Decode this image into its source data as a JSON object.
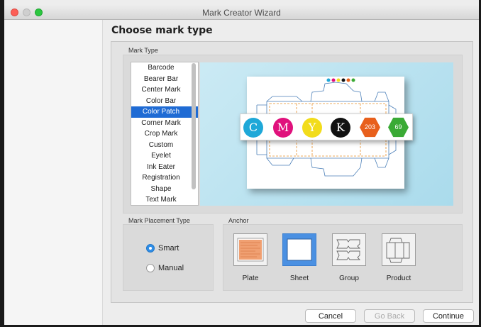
{
  "window": {
    "title": "Mark Creator Wizard"
  },
  "heading": "Choose mark type",
  "mark_type": {
    "label": "Mark Type",
    "items": [
      "Barcode",
      "Bearer Bar",
      "Center Mark",
      "Color Bar",
      "Color Patch",
      "Corner Mark",
      "Crop Mark",
      "Custom",
      "Eyelet",
      "Ink Eater",
      "Registration",
      "Shape",
      "Text Mark"
    ],
    "selected": "Color Patch"
  },
  "preview": {
    "patches": [
      {
        "label": "C",
        "color": "#1fa8d8"
      },
      {
        "label": "M",
        "color": "#e0117c"
      },
      {
        "label": "Y",
        "color": "#f2dc1b"
      },
      {
        "label": "K",
        "color": "#111111"
      }
    ],
    "spot_patches": [
      {
        "label": "203",
        "color": "#e8601c"
      },
      {
        "label": "69",
        "color": "#3aaa35"
      }
    ]
  },
  "placement": {
    "label": "Mark Placement Type",
    "options": [
      {
        "label": "Smart",
        "checked": true
      },
      {
        "label": "Manual",
        "checked": false
      }
    ]
  },
  "anchor": {
    "label": "Anchor",
    "options": [
      {
        "label": "Plate",
        "icon": "plate-icon"
      },
      {
        "label": "Sheet",
        "icon": "sheet-icon",
        "selected": true
      },
      {
        "label": "Group",
        "icon": "group-icon"
      },
      {
        "label": "Product",
        "icon": "product-icon"
      }
    ]
  },
  "buttons": {
    "cancel": "Cancel",
    "back": "Go Back",
    "continue": "Continue"
  }
}
